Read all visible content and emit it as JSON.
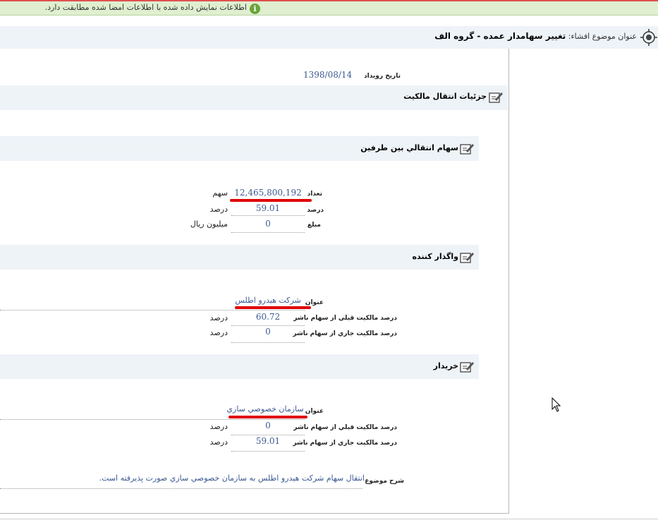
{
  "info_bar": {
    "message": "اطلاعات نمایش داده شده با اطلاعات امضا شده مطابقت دارد.",
    "icon": "info-icon"
  },
  "header": {
    "subject_label": "عنوان موضوع افشاء:",
    "subject_value": "تغيير سهامدار عمده - گروه الف",
    "icon": "target-icon"
  },
  "event": {
    "date_label": "تاريخ رويداد",
    "date_value": "1398/08/14"
  },
  "sections": {
    "ownership_transfer": "جزئيات انتقال مالكيت",
    "shares_transferred": "سهام انتقالي بين طرفين",
    "transferor": "واگذار كننده",
    "buyer": "خريدار"
  },
  "shares": {
    "count_label": "تعداد",
    "count_value": "12,465,800,192",
    "count_unit": "سهم",
    "percent_label": "درصد",
    "percent_value": "59.01",
    "percent_unit": "درصد",
    "amount_label": "مبلغ",
    "amount_value": "0",
    "amount_unit": "ميليون ريال"
  },
  "transferor": {
    "title_label": "عنوان",
    "title_value": "شركت هيدرو اطلس",
    "prev_label": "درصد مالكيت قبلي از سهام ناشر",
    "prev_value": "60.72",
    "prev_unit": "درصد",
    "curr_label": "درصد مالكيت جاري از سهام ناشر",
    "curr_value": "0",
    "curr_unit": "درصد"
  },
  "buyer": {
    "title_label": "عنوان",
    "title_value": "سازمان خصوصي سازي",
    "prev_label": "درصد مالكيت قبلي از سهام ناشر",
    "prev_value": "0",
    "prev_unit": "درصد",
    "curr_label": "درصد مالكيت جاري از سهام ناشر",
    "curr_value": "59.01",
    "curr_unit": "درصد"
  },
  "description": {
    "label": "شرح موضوع",
    "value": "انتقال سهام شركت هيدرو اطلس به سازمان خصوصي سازي صورت پذيرفته است."
  },
  "colors": {
    "value_text": "#3c5a91",
    "section_bg": "#eef3f8",
    "info_bg": "#dfefcf",
    "highlight": "#e00000"
  }
}
